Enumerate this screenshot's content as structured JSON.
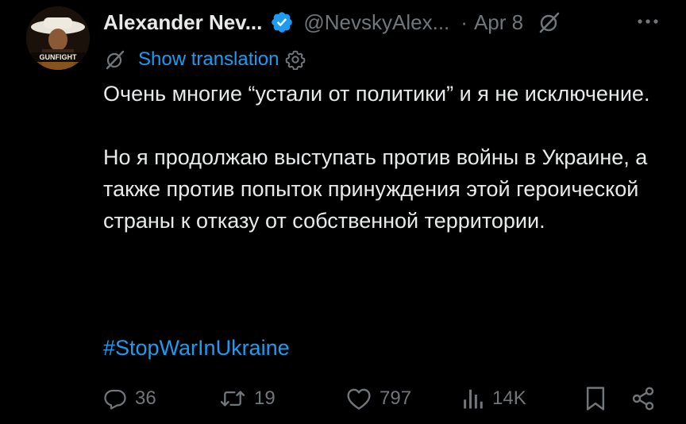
{
  "author": {
    "name": "Alexander Nev...",
    "handle": "@NevskyAlex...",
    "separator": "·",
    "date": "Apr 8",
    "avatar_text": "GUNFIGHT"
  },
  "translation": {
    "link": "Show translation"
  },
  "tweet": {
    "paragraph1": "Очень многие “устали от политики” и я не исключение.",
    "paragraph2": "Но я продолжаю выступать против войны в Украине, а также против попыток принуждения этой героической страны к отказу от собственной территории.",
    "hashtag": "#StopWarInUkraine"
  },
  "actions": {
    "replies": "36",
    "reposts": "19",
    "likes": "797",
    "views": "14K"
  },
  "colors": {
    "background": "#000000",
    "text": "#e7e9ea",
    "muted": "#71767b",
    "accent": "#1d9bf0"
  },
  "icons": {
    "verified": "verified-badge-icon",
    "grok": "grok-icon",
    "more": "more-icon",
    "translate": "grok-icon",
    "settings": "gear-icon",
    "reply": "reply-icon",
    "repost": "repost-icon",
    "like": "heart-icon",
    "views": "views-icon",
    "bookmark": "bookmark-icon",
    "share": "share-icon"
  }
}
